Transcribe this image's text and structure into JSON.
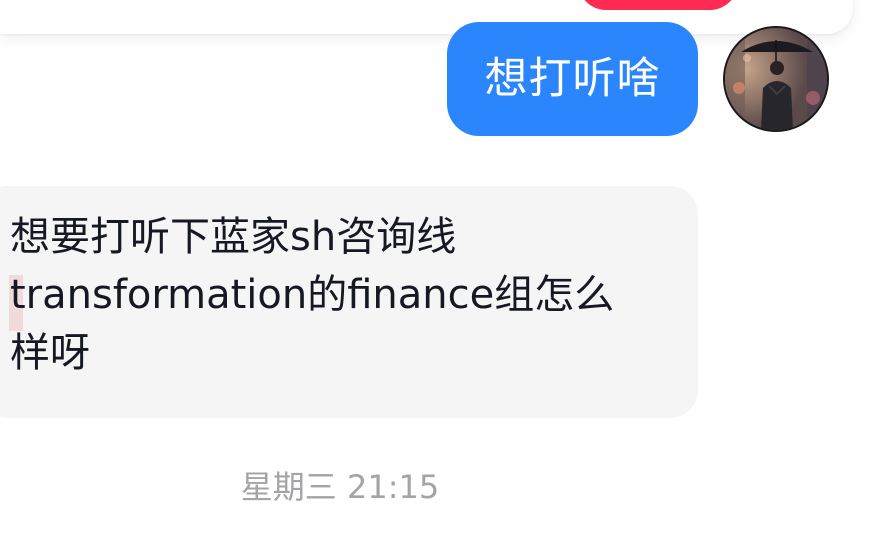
{
  "conversation": {
    "outgoing": {
      "text": "想打听啥"
    },
    "incoming": {
      "lines": [
        "想要打听下蓝家sh咨询线",
        "transformation的finance组怎么",
        "样呀"
      ]
    },
    "timestamp": "星期三 21:15"
  },
  "colors": {
    "outgoing_bubble": "#2b86fe",
    "incoming_bubble": "#f5f5f6",
    "accent_red": "#fe2c55",
    "timestamp_text": "#a3a3a8"
  }
}
